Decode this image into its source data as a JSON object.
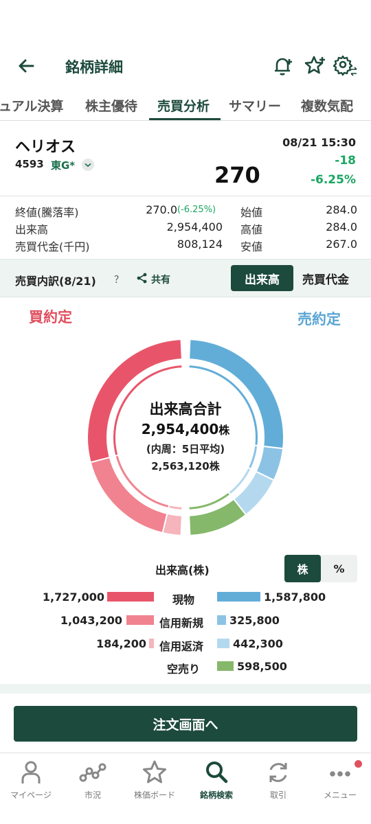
{
  "header": {
    "title": "銘柄詳細"
  },
  "tabs": [
    {
      "label": "ュアル決算"
    },
    {
      "label": "株主優待"
    },
    {
      "label": "売買分析",
      "active": true
    },
    {
      "label": "サマリー"
    },
    {
      "label": "複数気配"
    }
  ],
  "stock": {
    "name": "ヘリオス",
    "code": "4593",
    "market": "東G*",
    "price": "270",
    "datetime": "08/21 15:30",
    "change": "-18",
    "change_pct": "-6.25%"
  },
  "stats": {
    "close_label": "終値(騰落率)",
    "close_value": "270.0",
    "close_pct": "(-6.25%)",
    "volume_label": "出来高",
    "volume_value": "2,954,400",
    "turnover_label": "売買代金(千円)",
    "turnover_value": "808,124",
    "open_label": "始値",
    "open_value": "284.0",
    "high_label": "高値",
    "high_value": "284.0",
    "low_label": "安値",
    "low_value": "267.0"
  },
  "breakdown": {
    "title": "売買内訳(8/21)",
    "help": "？",
    "share_label": "共有",
    "seg_volume": "出来高",
    "seg_value": "売買代金"
  },
  "chart": {
    "buy_label": "買約定",
    "sell_label": "売約定",
    "center_title": "出来高合計",
    "center_total": "2,954,400",
    "center_unit": "株",
    "center_note": "(内周：5日平均)",
    "center_avg": "2,563,120",
    "center_avg_unit": "株"
  },
  "chart_data": {
    "type": "pie",
    "title": "出来高(株)",
    "buy": [
      {
        "name": "現物",
        "value": 1727000,
        "color": "#e8556a"
      },
      {
        "name": "信用新規",
        "value": 1043200,
        "color": "#f0838f"
      },
      {
        "name": "信用返済",
        "value": 184200,
        "color": "#f6b4bc"
      }
    ],
    "sell": [
      {
        "name": "現物",
        "value": 1587800,
        "color": "#62add8"
      },
      {
        "name": "信用新規",
        "value": 325800,
        "color": "#8cc3e5"
      },
      {
        "name": "信用返済",
        "value": 442300,
        "color": "#b4d9ef"
      },
      {
        "name": "空売り",
        "value": 598500,
        "color": "#85b86a"
      }
    ]
  },
  "legend": {
    "title": "出来高(株)",
    "unit_shares": "株",
    "unit_pct": "%",
    "rows": [
      {
        "buy": "1,727,000",
        "name": "現物",
        "sell": "1,587,800"
      },
      {
        "buy": "1,043,200",
        "name": "信用新規",
        "sell": "325,800"
      },
      {
        "buy": "184,200",
        "name": "信用返済",
        "sell": "442,300"
      },
      {
        "buy": "",
        "name": "空売り",
        "sell": "598,500"
      }
    ]
  },
  "order_button": "注文画面へ",
  "nav": [
    {
      "label": "マイページ",
      "icon": "person-icon"
    },
    {
      "label": "市況",
      "icon": "market-icon"
    },
    {
      "label": "株価ボード",
      "icon": "star-icon"
    },
    {
      "label": "銘柄検索",
      "icon": "search-icon",
      "active": true
    },
    {
      "label": "取引",
      "icon": "trade-icon"
    },
    {
      "label": "メニュー",
      "icon": "more-icon"
    }
  ],
  "colors": {
    "brand": "#1c4a3c",
    "up": "#1aa661",
    "buy": "#e0505f",
    "sell": "#5aa5d4"
  }
}
